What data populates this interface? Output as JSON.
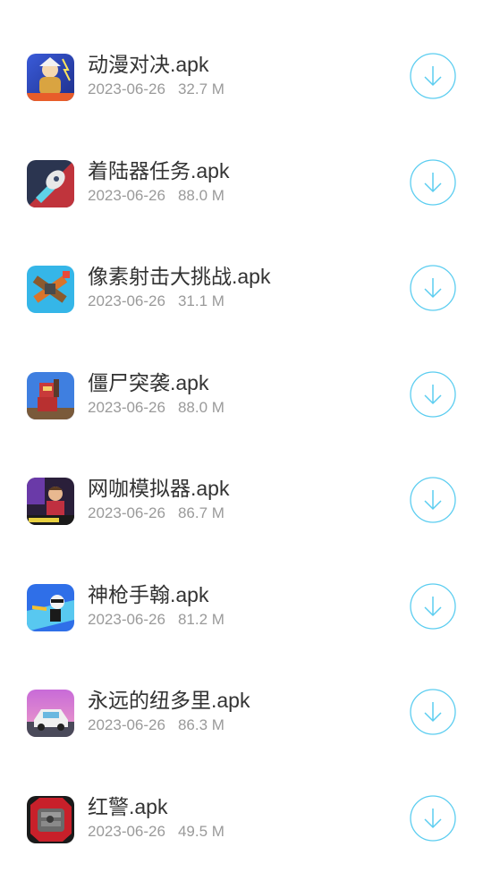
{
  "accent_color": "#5bcdf0",
  "downloads": [
    {
      "name": "动漫对决.apk",
      "date": "2023-06-26",
      "size": "32.7 M",
      "icon": "anime-duel-icon"
    },
    {
      "name": "着陆器任务.apk",
      "date": "2023-06-26",
      "size": "88.0 M",
      "icon": "lander-mission-icon"
    },
    {
      "name": "像素射击大挑战.apk",
      "date": "2023-06-26",
      "size": "31.1 M",
      "icon": "pixel-shooter-icon"
    },
    {
      "name": "僵尸突袭.apk",
      "date": "2023-06-26",
      "size": "88.0 M",
      "icon": "zombie-raid-icon"
    },
    {
      "name": "网咖模拟器.apk",
      "date": "2023-06-26",
      "size": "86.7 M",
      "icon": "net-cafe-simulator-icon"
    },
    {
      "name": "神枪手翰.apk",
      "date": "2023-06-26",
      "size": "81.2 M",
      "icon": "sharpshooter-icon"
    },
    {
      "name": "永远的纽多里.apk",
      "date": "2023-06-26",
      "size": "86.3 M",
      "icon": "forever-car-icon"
    },
    {
      "name": "红警.apk",
      "date": "2023-06-26",
      "size": "49.5 M",
      "icon": "red-alert-icon"
    }
  ]
}
